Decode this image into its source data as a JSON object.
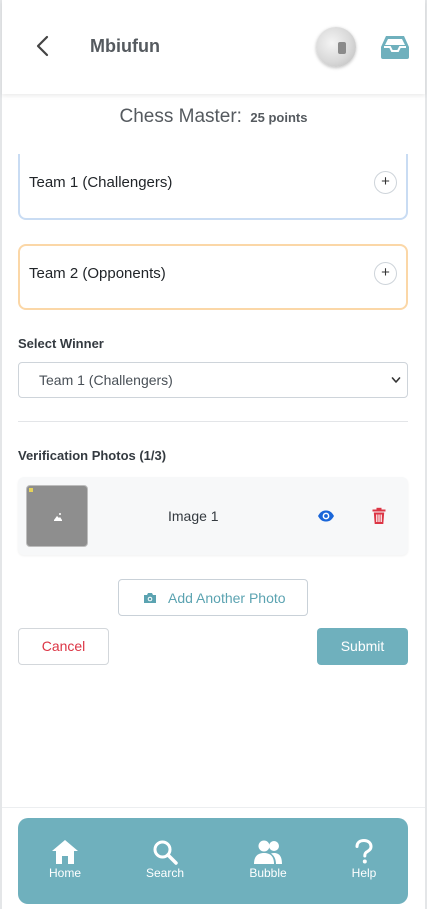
{
  "header": {
    "app_name": "Mbiufun"
  },
  "game": {
    "name": "Chess Master:",
    "points": "25 points"
  },
  "teams": [
    {
      "label": "Team 1 (Challengers)",
      "add_label": "+"
    },
    {
      "label": "Team 2 (Opponents)",
      "add_label": "+"
    }
  ],
  "winner": {
    "label": "Select Winner",
    "selected": "Team 1 (Challengers)"
  },
  "photos": {
    "label": "Verification Photos (1/3)",
    "items": [
      {
        "name": "Image 1"
      }
    ],
    "add_label": "Add Another Photo"
  },
  "actions": {
    "cancel": "Cancel",
    "submit": "Submit"
  },
  "nav": {
    "items": [
      {
        "label": "Home",
        "icon": "home-icon"
      },
      {
        "label": "Search",
        "icon": "search-icon"
      },
      {
        "label": "Bubble",
        "icon": "users-icon"
      },
      {
        "label": "Help",
        "icon": "question-icon"
      }
    ]
  },
  "colors": {
    "accent": "#6fb0bd",
    "team1_border": "#c9dcf3",
    "team2_border": "#fbd7a7",
    "danger": "#dc3545",
    "view_icon": "#1a66d9"
  }
}
